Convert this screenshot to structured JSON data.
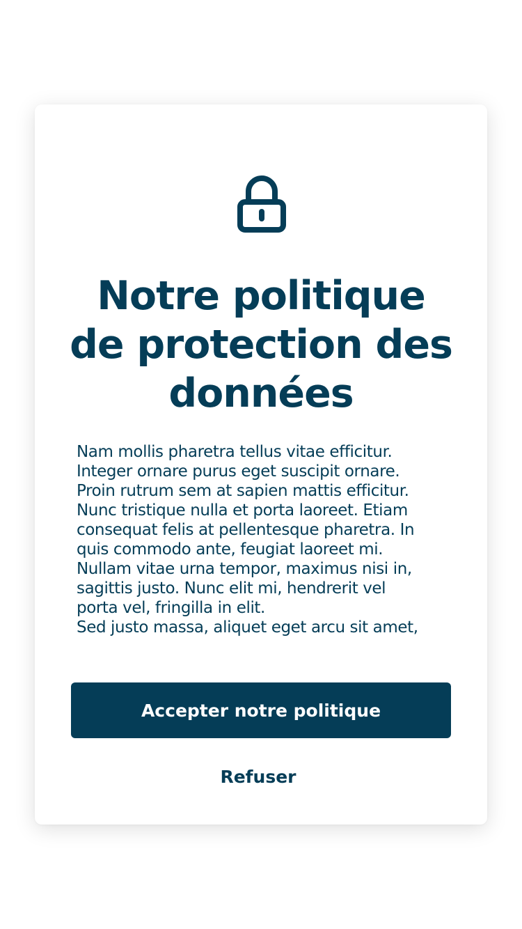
{
  "dialog": {
    "icon": "lock-icon",
    "title": "Notre politique\nde protection des données",
    "body": "Nam mollis pharetra tellus vitae efficitur.\nInteger ornare purus eget suscipit ornare.\nProin rutrum sem at sapien mattis efficitur.\nNunc tristique nulla et porta laoreet. Etiam\nconsequat felis at pellentesque pharetra. In\nquis commodo ante, feugiat laoreet mi.\nNullam vitae urna tempor, maximus nisi in,\nsagittis justo. Nunc elit mi, hendrerit vel\nporta vel, fringilla in elit.\nSed justo massa, aliquet eget arcu sit amet,",
    "accept_label": "Accepter notre politique",
    "refuse_label": "Refuser"
  },
  "colors": {
    "primary": "#053d57",
    "background": "#ffffff"
  }
}
